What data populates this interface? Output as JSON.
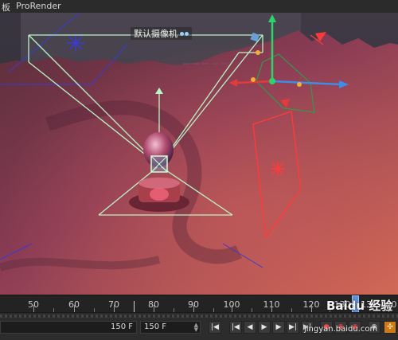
{
  "menu": {
    "items": [
      "板",
      "ProRender"
    ]
  },
  "viewport": {
    "camera_label": "默认摄像机",
    "colors": {
      "ground_top": "#5a2e3a",
      "ground_bottom": "#c9546a",
      "frustum": "#a8f0b8",
      "gizmo_x": "#e23b3b",
      "gizmo_y": "#2fd36b",
      "gizmo_z": "#3f8ce6",
      "light_red": "#ff3a3a",
      "light_blue": "#3b3bff"
    }
  },
  "timeline": {
    "ruler": [
      "50",
      "60",
      "70",
      "80",
      "90",
      "100",
      "110",
      "120",
      "130",
      "131",
      "140"
    ],
    "current_frame": "131"
  },
  "transport": {
    "end_frame": "150 F",
    "max_frame": "150 F",
    "buttons": [
      "first-frame",
      "prev-key",
      "prev-frame",
      "play",
      "next-frame",
      "next-key",
      "last-frame",
      "record",
      "auto-key",
      "keyframe-settings"
    ]
  },
  "watermark": {
    "brand": "Baidu 经验",
    "url": "jingyan.baidu.com"
  }
}
